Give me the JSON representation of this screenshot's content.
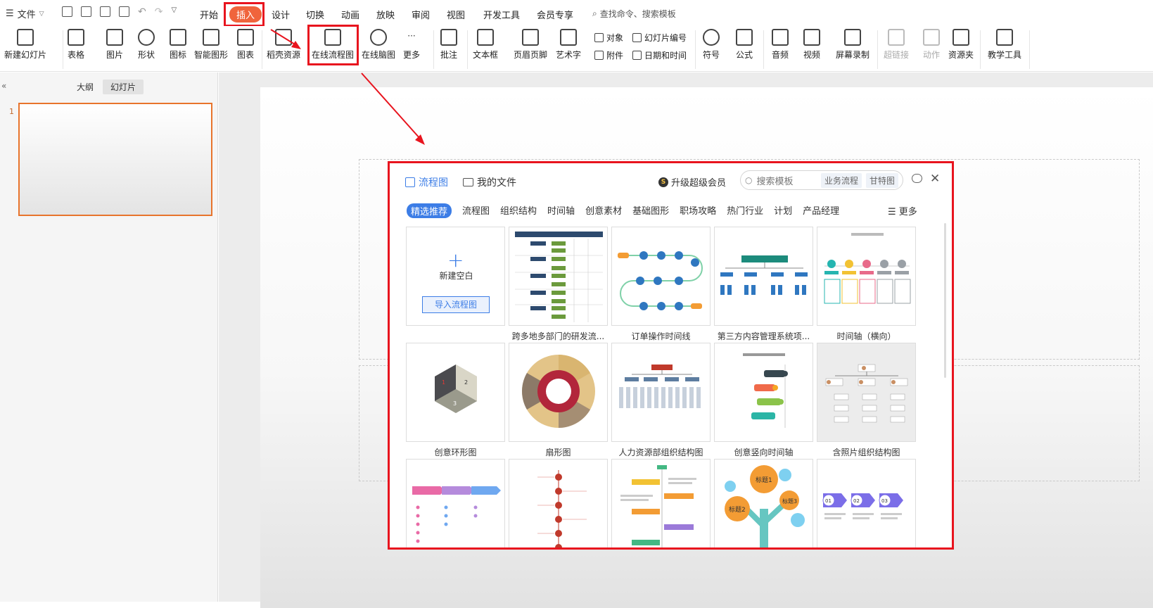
{
  "menubar": {
    "file_label": "文件",
    "tabs": [
      "开始",
      "插入",
      "设计",
      "切换",
      "动画",
      "放映",
      "审阅",
      "视图",
      "开发工具",
      "会员专享"
    ],
    "active_tab": "插入",
    "search_placeholder": "查找命令、搜索模板"
  },
  "ribbon": {
    "buttons": [
      {
        "label": "新建幻灯片",
        "icon": "new-slide-icon"
      },
      {
        "label": "表格",
        "icon": "table-icon"
      },
      {
        "label": "图片",
        "icon": "picture-icon"
      },
      {
        "label": "形状",
        "icon": "shape-icon"
      },
      {
        "label": "图标",
        "icon": "icons-icon"
      },
      {
        "label": "智能图形",
        "icon": "smartart-icon"
      },
      {
        "label": "图表",
        "icon": "chart-icon"
      },
      {
        "label": "稻壳资源",
        "icon": "docer-resource-icon"
      },
      {
        "label": "在线流程图",
        "icon": "online-flowchart-icon"
      },
      {
        "label": "在线脑图",
        "icon": "online-mindmap-icon"
      },
      {
        "label": "更多",
        "icon": "more-icon"
      },
      {
        "label": "批注",
        "icon": "comment-icon"
      },
      {
        "label": "文本框",
        "icon": "textbox-icon"
      },
      {
        "label": "页眉页脚",
        "icon": "header-footer-icon"
      },
      {
        "label": "艺术字",
        "icon": "wordart-icon"
      },
      {
        "label": "符号",
        "icon": "symbol-icon"
      },
      {
        "label": "公式",
        "icon": "formula-icon"
      },
      {
        "label": "音频",
        "icon": "audio-icon"
      },
      {
        "label": "视频",
        "icon": "video-icon"
      },
      {
        "label": "屏幕录制",
        "icon": "screen-record-icon"
      },
      {
        "label": "超链接",
        "icon": "hyperlink-icon"
      },
      {
        "label": "动作",
        "icon": "action-icon"
      },
      {
        "label": "资源夹",
        "icon": "resource-folder-icon"
      },
      {
        "label": "教学工具",
        "icon": "teaching-tools-icon"
      }
    ],
    "small": {
      "object": "对象",
      "slide_number": "幻灯片编号",
      "attachment": "附件",
      "date_time": "日期和时间"
    }
  },
  "left_pane": {
    "tab_outline": "大纲",
    "tab_slides": "幻灯片",
    "slide_number": "1",
    "collapse": "«"
  },
  "popup": {
    "tab_flowchart": "流程图",
    "tab_my_files": "我的文件",
    "upgrade": "升级超级会员",
    "search_placeholder": "搜索模板",
    "chip1": "业务流程",
    "chip2": "甘特图",
    "categories": [
      "精选推荐",
      "流程图",
      "组织结构",
      "时间轴",
      "创意素材",
      "基础图形",
      "职场攻略",
      "热门行业",
      "计划",
      "产品经理"
    ],
    "active_category": "精选推荐",
    "more": "更多",
    "new_blank": "新建空白",
    "import_btn": "导入流程图",
    "cards": [
      "跨多地多部门的研发流...",
      "订单操作时间线",
      "第三方内容管理系统项...",
      "时间轴（横向）",
      "创意环形图",
      "扇形图",
      "人力资源部组织结构图",
      "创意竖向时间轴",
      "含照片组织结构图"
    ],
    "thumb_texts": {
      "hex_1": "1",
      "hex_2": "2",
      "hex_3": "3",
      "tree_t1": "标题1",
      "tree_t2": "标题2",
      "tree_t3": "标题3",
      "arrow_a": "01",
      "arrow_b": "02",
      "arrow_c": "03"
    }
  },
  "colors": {
    "accent_orange": "#f0643c",
    "annotation_red": "#e8141e",
    "popup_blue": "#3c7de6"
  }
}
